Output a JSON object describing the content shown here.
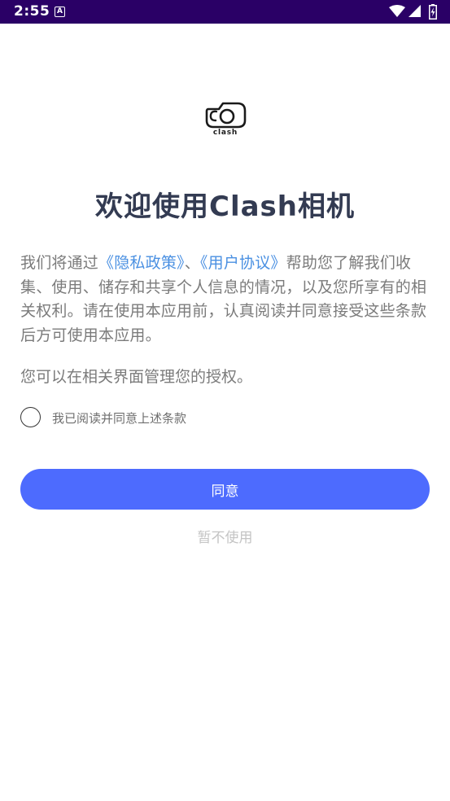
{
  "status_bar": {
    "time": "2:55",
    "notification_icon_letter": "A",
    "icons": [
      "wifi-icon",
      "signal-icon",
      "battery-icon"
    ]
  },
  "logo": {
    "text": "clash",
    "icon": "camera-logo-icon"
  },
  "title": "欢迎使用Clash相机",
  "agreement": {
    "intro": "我们将通过",
    "privacy_link": "《隐私政策》",
    "separator": "、",
    "terms_link": "《用户协议》",
    "body": "帮助您了解我们收集、使用、储存和共享个人信息的情况，以及您所享有的相关权利。请在使用本应用前，认真阅读并同意接受这些条款后方可使用本应用。",
    "manage_note": "您可以在相关界面管理您的授权。"
  },
  "consent": {
    "label": "我已阅读并同意上述条款",
    "checked": false
  },
  "buttons": {
    "agree": "同意",
    "decline": "暂不使用"
  },
  "colors": {
    "status_bar": "#2a0066",
    "title": "#333b52",
    "link": "#4a90e2",
    "primary_button": "#4d6bfe",
    "decline_text": "#c4c4c4"
  }
}
